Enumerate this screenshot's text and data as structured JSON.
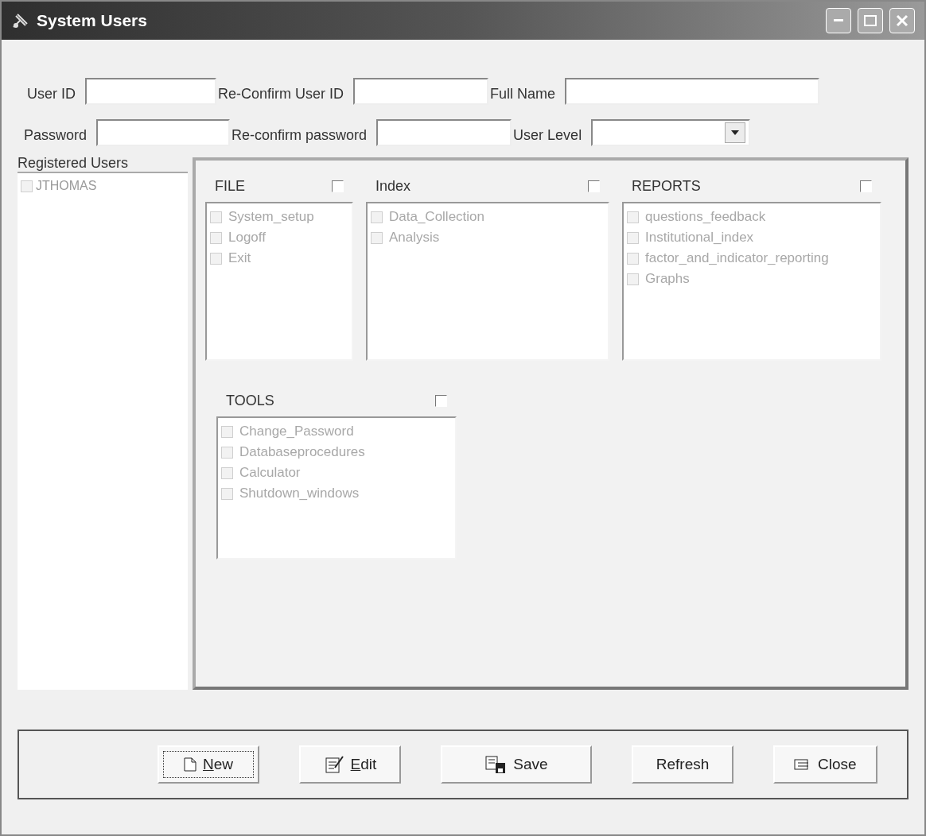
{
  "window": {
    "title": "System Users"
  },
  "fields": [
    {
      "label": "User ID"
    },
    {
      "label": "Re-Confirm User ID"
    },
    {
      "label": "Full Name"
    },
    {
      "label": "Password"
    },
    {
      "label": "Re-confirm password"
    },
    {
      "label": "User Level",
      "kind": "dropdown"
    }
  ],
  "registered_users": {
    "label": "Registered Users",
    "items": [
      {
        "name": "JTHOMAS",
        "checked": false,
        "disabled": true
      }
    ]
  },
  "groups": [
    {
      "title": "FILE",
      "checked": false,
      "items": [
        {
          "name": "System_setup",
          "checked": false,
          "disabled": true
        },
        {
          "name": "Logoff",
          "checked": false,
          "disabled": true
        },
        {
          "name": "Exit",
          "checked": false,
          "disabled": true
        }
      ]
    },
    {
      "title": "Index",
      "checked": false,
      "items": [
        {
          "name": "Data_Collection",
          "checked": false,
          "disabled": true
        },
        {
          "name": "Analysis",
          "checked": false,
          "disabled": true
        }
      ]
    },
    {
      "title": "REPORTS",
      "checked": false,
      "items": [
        {
          "name": "questions_feedback",
          "checked": false,
          "disabled": true
        },
        {
          "name": "Institutional_index",
          "checked": false,
          "disabled": true
        },
        {
          "name": "factor_and_indicator_reporting",
          "checked": false,
          "disabled": true
        },
        {
          "name": "Graphs",
          "checked": false,
          "disabled": true
        }
      ]
    },
    {
      "title": "TOOLS",
      "checked": false,
      "items": [
        {
          "name": "Change_Password",
          "checked": false,
          "disabled": true
        },
        {
          "name": "Databaseprocedures",
          "checked": false,
          "disabled": true
        },
        {
          "name": "Calculator",
          "checked": false,
          "disabled": true
        },
        {
          "name": "Shutdown_windows",
          "checked": false,
          "disabled": true
        }
      ]
    }
  ],
  "buttons": [
    {
      "label": "New",
      "kind": "new",
      "mnemonic": true,
      "focused": true
    },
    {
      "label": "Edit",
      "kind": "edit",
      "mnemonic": true,
      "focused": false
    },
    {
      "label": "Save",
      "kind": "save",
      "mnemonic": false,
      "focused": false
    },
    {
      "label": "Refresh",
      "kind": "refresh",
      "mnemonic": false,
      "focused": false
    },
    {
      "label": "Close",
      "kind": "close",
      "mnemonic": false,
      "focused": false
    }
  ]
}
